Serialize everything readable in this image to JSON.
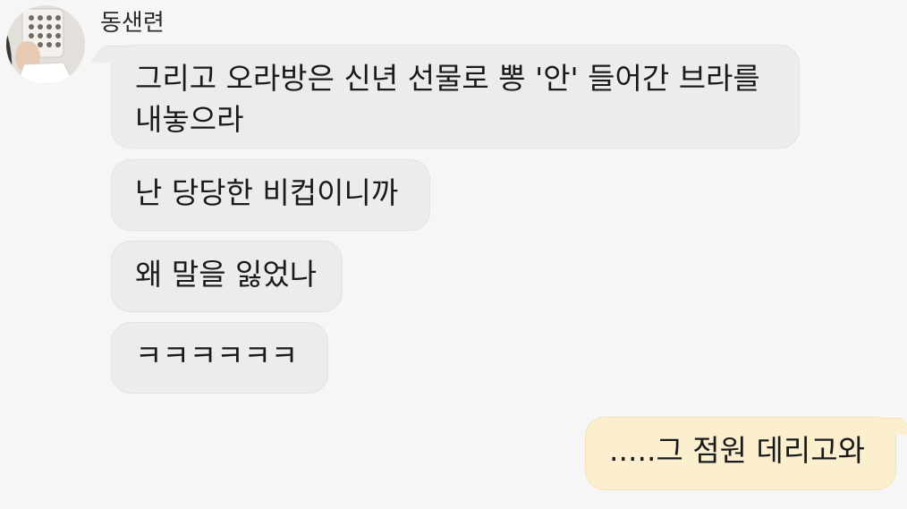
{
  "conversation": {
    "sender_name": "동샌련",
    "messages": [
      {
        "direction": "incoming",
        "text": "그리고 오라방은 신년 선물로 뽕 '안' 들어간 브라를 내놓으라"
      },
      {
        "direction": "incoming",
        "text": "난 당당한 비컵이니까"
      },
      {
        "direction": "incoming",
        "text": "왜 말을 잃었나"
      },
      {
        "direction": "incoming",
        "text": "ㅋㅋㅋㅋㅋㅋ"
      },
      {
        "direction": "outgoing",
        "text": ".....그 점원 데리고와"
      }
    ]
  },
  "colors": {
    "background": "#f6f6f6",
    "incoming_bubble": "#ececec",
    "outgoing_bubble": "#fbefcf"
  }
}
